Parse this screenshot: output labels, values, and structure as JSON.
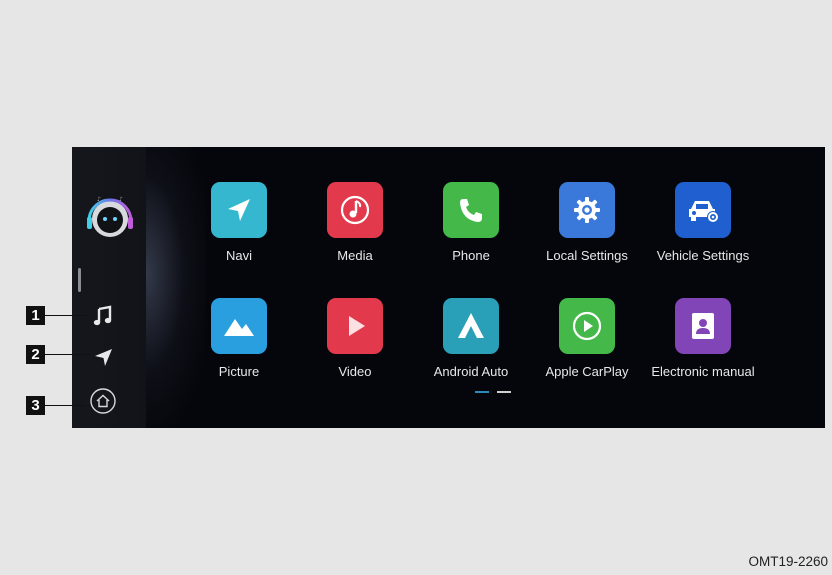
{
  "apps": [
    {
      "label": "Navi",
      "icon": "navigation-arrow-icon",
      "color": "#35b8cf"
    },
    {
      "label": "Media",
      "icon": "music-note-icon",
      "color": "#e23a4c"
    },
    {
      "label": "Phone",
      "icon": "phone-icon",
      "color": "#45b84a"
    },
    {
      "label": "Local Settings",
      "icon": "gear-icon",
      "color": "#3a79d9"
    },
    {
      "label": "Vehicle Settings",
      "icon": "car-settings-icon",
      "color": "#1f5fcf"
    },
    {
      "label": "Picture",
      "icon": "mountain-picture-icon",
      "color": "#2a9fe0"
    },
    {
      "label": "Video",
      "icon": "play-icon",
      "color": "#e23a4c"
    },
    {
      "label": "Android Auto",
      "icon": "android-auto-icon",
      "color": "#2aa0b8"
    },
    {
      "label": "Apple CarPlay",
      "icon": "carplay-icon",
      "color": "#45b84a"
    },
    {
      "label": "Electronic manual",
      "icon": "manual-person-icon",
      "color": "#8245b8"
    }
  ],
  "sidebar": {
    "items": [
      {
        "callout": "1",
        "icon": "music-icon"
      },
      {
        "callout": "2",
        "icon": "navigation-icon"
      },
      {
        "callout": "3",
        "icon": "home-icon"
      }
    ]
  },
  "pager": {
    "pages": 2,
    "current": 1
  },
  "caption": "OMT19-2260"
}
